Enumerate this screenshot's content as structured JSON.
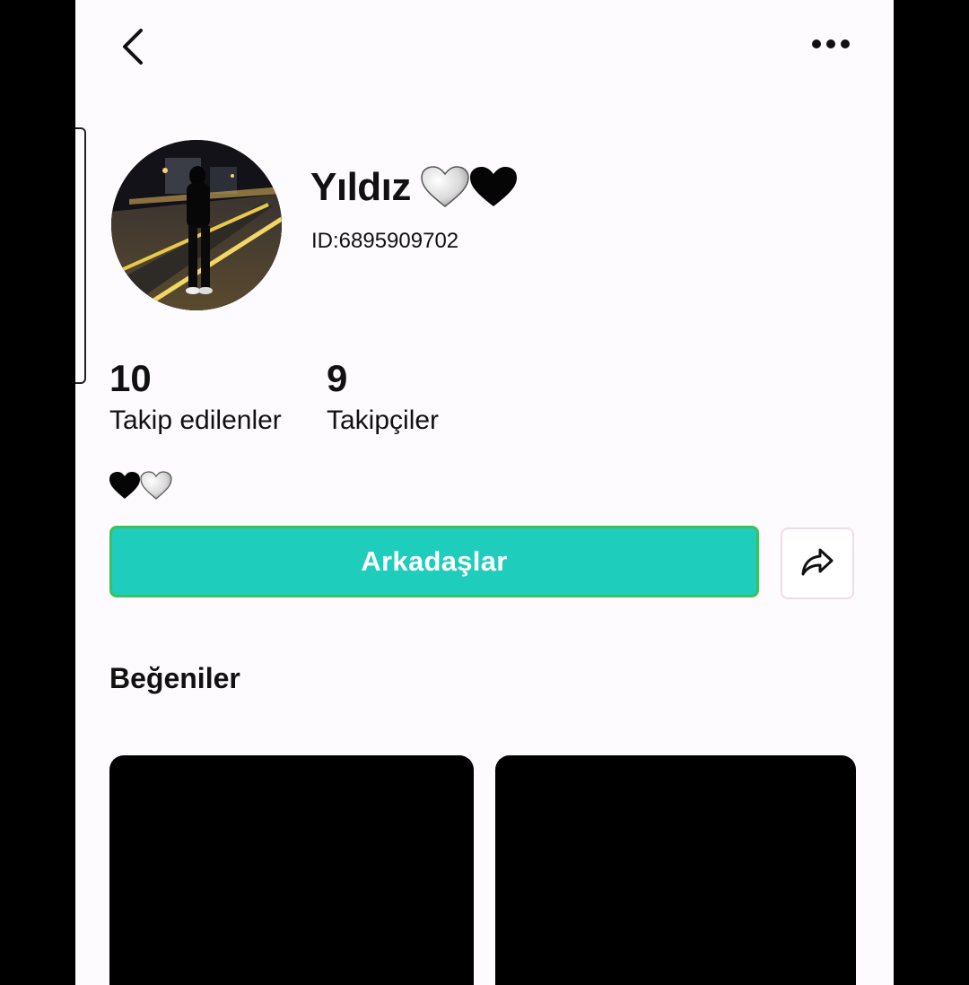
{
  "header": {
    "back_icon": "chevron-left-icon",
    "more_icon": "more-horizontal-icon"
  },
  "profile": {
    "name": "Yıldız",
    "name_emoji": "🤍🖤",
    "id_text": "ID:6895909702",
    "avatar_alt": "night street photo of a person"
  },
  "stats": {
    "following_count": "10",
    "following_label": "Takip edilenler",
    "followers_count": "9",
    "followers_label": "Takipçiler"
  },
  "bio": {
    "emoji": "🖤🤍"
  },
  "actions": {
    "friends_label": "Arkadaşlar",
    "share_icon": "share-arrow-icon",
    "friends_color": "#1ecdbc"
  },
  "likes": {
    "title": "Beğeniler"
  }
}
